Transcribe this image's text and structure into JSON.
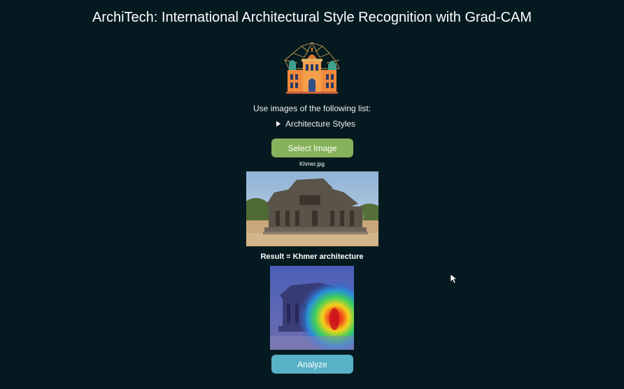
{
  "header": {
    "title": "ArchiTech: International Architectural Style Recognition with Grad-CAM"
  },
  "logo": {
    "icon": "architecture-logo-icon"
  },
  "instructions": {
    "text": "Use images of the following list:"
  },
  "styles_list": {
    "summary_label": "Architecture Styles",
    "expanded": false
  },
  "upload": {
    "button_label": "Select Image",
    "filename": "Khmer.jpg"
  },
  "result": {
    "text": "Result = Khmer architecture"
  },
  "actions": {
    "analyze_label": "Analyze"
  },
  "colors": {
    "background": "#051a20",
    "select_button": "#86b25b",
    "analyze_button": "#58b2c7"
  }
}
